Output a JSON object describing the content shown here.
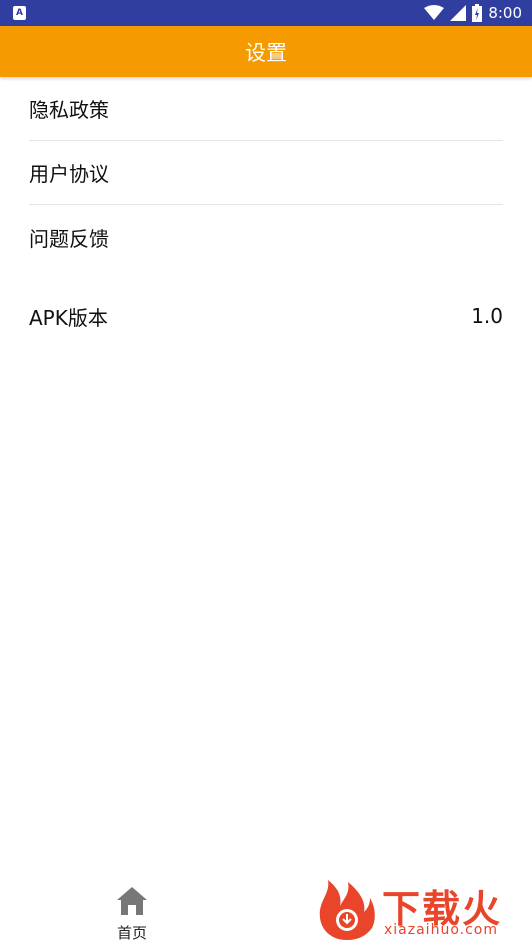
{
  "status_bar": {
    "app_icon_letter": "A",
    "time": "8:00",
    "battery_level": 0.8
  },
  "app_bar": {
    "title": "设置"
  },
  "settings": {
    "privacy_policy": "隐私政策",
    "user_agreement": "用户协议",
    "feedback": "问题反馈",
    "apk_version_label": "APK版本",
    "apk_version_value": "1.0"
  },
  "bottom_nav": {
    "home_label": "首页"
  },
  "watermark": {
    "brand": "下载火",
    "url": "xiazaihuo.com"
  },
  "colors": {
    "status_bar": "#303f9f",
    "app_bar": "#f59a00",
    "watermark": "#e8452b"
  },
  "icons": [
    "app-notification-icon",
    "wifi-icon",
    "signal-icon",
    "battery-icon",
    "home-icon",
    "flame-logo-icon"
  ]
}
